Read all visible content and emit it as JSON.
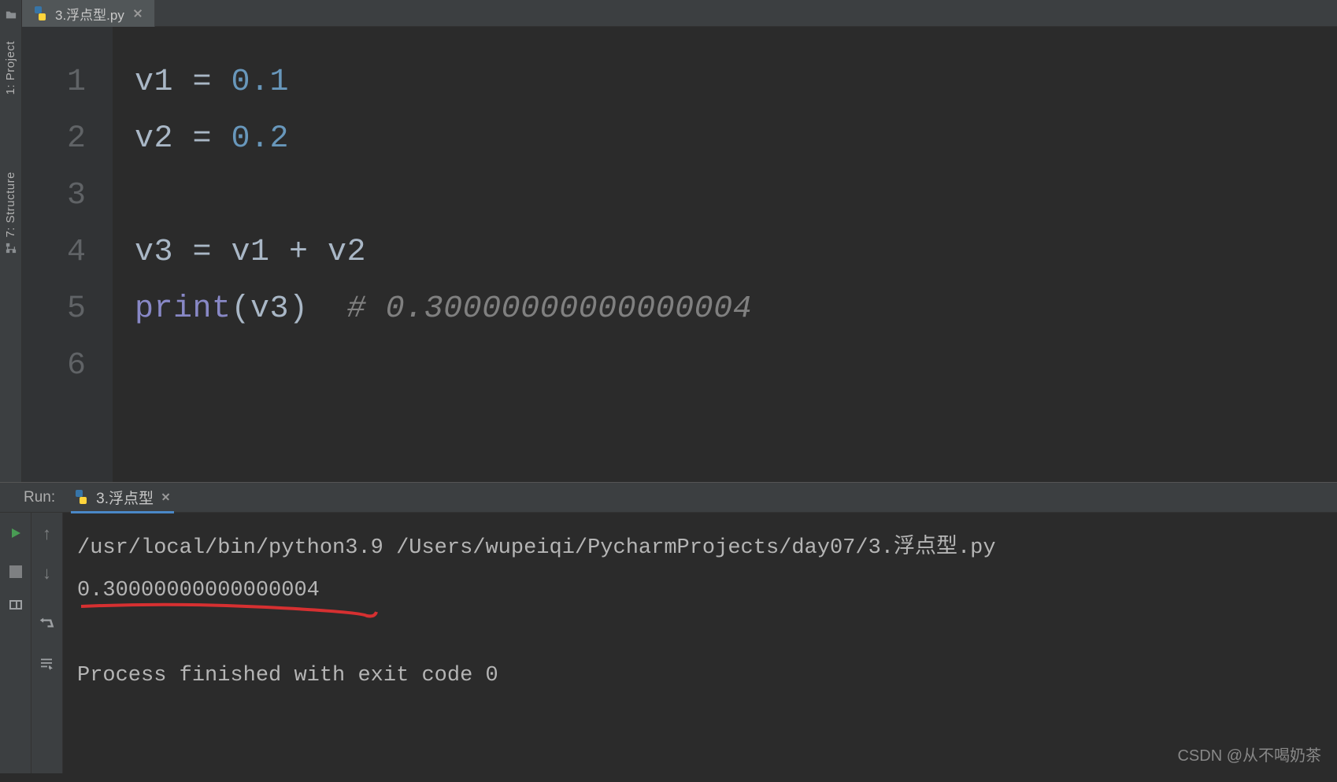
{
  "sidebar": {
    "project_label": "1: Project",
    "structure_label": "7: Structure"
  },
  "editorTab": {
    "filename": "3.浮点型.py"
  },
  "gutter": [
    "1",
    "2",
    "3",
    "4",
    "5",
    "6"
  ],
  "code": {
    "line1": {
      "a": "v1 = ",
      "b": "0.1"
    },
    "line2": {
      "a": "v2 = ",
      "b": "0.2"
    },
    "line3": "",
    "line4": "v3 = v1 + v2",
    "line5": {
      "a": "print",
      "b": "(v3)  ",
      "c": "# 0.30000000000000004"
    },
    "line6": ""
  },
  "run": {
    "label": "Run:",
    "tab_name": "3.浮点型",
    "console": {
      "cmd": "/usr/local/bin/python3.9 /Users/wupeiqi/PycharmProjects/day07/3.浮点型.py",
      "out": "0.30000000000000004",
      "exit": "Process finished with exit code 0"
    }
  },
  "watermark": "CSDN @从不喝奶茶"
}
